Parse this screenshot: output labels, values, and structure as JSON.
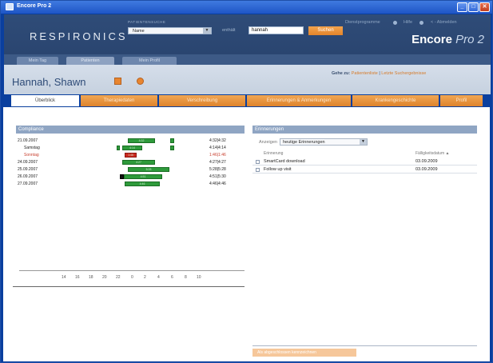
{
  "window": {
    "title": "Encore Pro 2"
  },
  "header": {
    "logo": "RESPIRONICS",
    "search_label": "PATIENTENSUCHE",
    "search_field": "Name",
    "contains_label": "enthält",
    "search_value": "hannah",
    "search_button": "Suchen",
    "links": {
      "tools": "Dienstprogramme",
      "help": "Hilfe",
      "logout": "< - Abmelden"
    },
    "brand_main": "Encore",
    "brand_pro": "Pro 2"
  },
  "nav": {
    "tabs": [
      {
        "label": "Mein Tag"
      },
      {
        "label": "Patienten"
      },
      {
        "label": "Mein Profil"
      }
    ]
  },
  "patient": {
    "name": "Hannah, Shawn",
    "goto_label": "Gehe zu:",
    "goto_list": "Patientenliste",
    "goto_sep": "|",
    "goto_results": "Letzte Suchergebnisse"
  },
  "subtabs": [
    {
      "label": "Überblick"
    },
    {
      "label": "Therapiedaten"
    },
    {
      "label": "Verschreibung"
    },
    {
      "label": "Erinnerungen & Anmerkungen"
    },
    {
      "label": "Krankengeschichte"
    },
    {
      "label": "Profil"
    }
  ],
  "compliance": {
    "title": "Compliance",
    "rows": [
      {
        "date": "21.09.2007",
        "value": "4:32|4:32",
        "red": false
      },
      {
        "date": "Samstag",
        "value": "4:14|4:14",
        "red": false
      },
      {
        "date": "Sonntag",
        "value": "1:46|1:46",
        "red": true
      },
      {
        "date": "24.09.2007",
        "value": "4:27|4:27",
        "red": false
      },
      {
        "date": "25.09.2007",
        "value": "5:28|5:28",
        "red": false
      },
      {
        "date": "26.09.2007",
        "value": "4:51|5:30",
        "red": false
      },
      {
        "date": "27.09.2007",
        "value": "4:46|4:46",
        "red": false
      }
    ],
    "axis_ticks": [
      "14",
      "16",
      "18",
      "20",
      "22",
      "0",
      "2",
      "4",
      "6",
      "8",
      "10"
    ]
  },
  "reminders": {
    "title": "Erinnerungen",
    "filter_label": "Anzeigen",
    "filter_value": "heutige Erinnerungen",
    "col_reminder": "Erinnerung",
    "col_due": "Fälligkeitsdatum ▲",
    "items": [
      {
        "text": "SmartCard download",
        "due": "03.09.2009"
      },
      {
        "text": "Follow up visit",
        "due": "03.09.2009"
      }
    ],
    "button": "Als abgeschlossen kennzeichnen"
  },
  "colors": {
    "accent_orange": "#e3852b",
    "header_navy": "#2f4c78",
    "bar_green": "#2e9a3b",
    "bar_red": "#cc2a1f"
  }
}
